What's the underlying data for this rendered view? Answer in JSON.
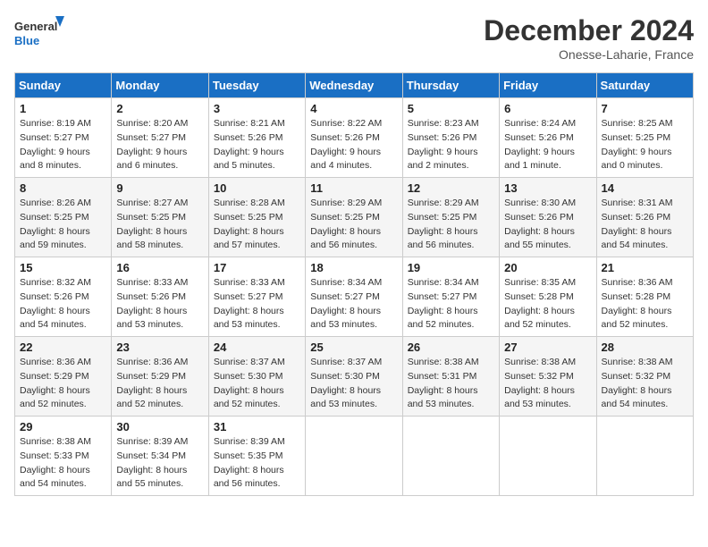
{
  "logo": {
    "line1": "General",
    "line2": "Blue"
  },
  "title": "December 2024",
  "subtitle": "Onesse-Laharie, France",
  "days_header": [
    "Sunday",
    "Monday",
    "Tuesday",
    "Wednesday",
    "Thursday",
    "Friday",
    "Saturday"
  ],
  "weeks": [
    [
      {
        "day": "1",
        "info": "Sunrise: 8:19 AM\nSunset: 5:27 PM\nDaylight: 9 hours\nand 8 minutes."
      },
      {
        "day": "2",
        "info": "Sunrise: 8:20 AM\nSunset: 5:27 PM\nDaylight: 9 hours\nand 6 minutes."
      },
      {
        "day": "3",
        "info": "Sunrise: 8:21 AM\nSunset: 5:26 PM\nDaylight: 9 hours\nand 5 minutes."
      },
      {
        "day": "4",
        "info": "Sunrise: 8:22 AM\nSunset: 5:26 PM\nDaylight: 9 hours\nand 4 minutes."
      },
      {
        "day": "5",
        "info": "Sunrise: 8:23 AM\nSunset: 5:26 PM\nDaylight: 9 hours\nand 2 minutes."
      },
      {
        "day": "6",
        "info": "Sunrise: 8:24 AM\nSunset: 5:26 PM\nDaylight: 9 hours\nand 1 minute."
      },
      {
        "day": "7",
        "info": "Sunrise: 8:25 AM\nSunset: 5:25 PM\nDaylight: 9 hours\nand 0 minutes."
      }
    ],
    [
      {
        "day": "8",
        "info": "Sunrise: 8:26 AM\nSunset: 5:25 PM\nDaylight: 8 hours\nand 59 minutes."
      },
      {
        "day": "9",
        "info": "Sunrise: 8:27 AM\nSunset: 5:25 PM\nDaylight: 8 hours\nand 58 minutes."
      },
      {
        "day": "10",
        "info": "Sunrise: 8:28 AM\nSunset: 5:25 PM\nDaylight: 8 hours\nand 57 minutes."
      },
      {
        "day": "11",
        "info": "Sunrise: 8:29 AM\nSunset: 5:25 PM\nDaylight: 8 hours\nand 56 minutes."
      },
      {
        "day": "12",
        "info": "Sunrise: 8:29 AM\nSunset: 5:25 PM\nDaylight: 8 hours\nand 56 minutes."
      },
      {
        "day": "13",
        "info": "Sunrise: 8:30 AM\nSunset: 5:26 PM\nDaylight: 8 hours\nand 55 minutes."
      },
      {
        "day": "14",
        "info": "Sunrise: 8:31 AM\nSunset: 5:26 PM\nDaylight: 8 hours\nand 54 minutes."
      }
    ],
    [
      {
        "day": "15",
        "info": "Sunrise: 8:32 AM\nSunset: 5:26 PM\nDaylight: 8 hours\nand 54 minutes."
      },
      {
        "day": "16",
        "info": "Sunrise: 8:33 AM\nSunset: 5:26 PM\nDaylight: 8 hours\nand 53 minutes."
      },
      {
        "day": "17",
        "info": "Sunrise: 8:33 AM\nSunset: 5:27 PM\nDaylight: 8 hours\nand 53 minutes."
      },
      {
        "day": "18",
        "info": "Sunrise: 8:34 AM\nSunset: 5:27 PM\nDaylight: 8 hours\nand 53 minutes."
      },
      {
        "day": "19",
        "info": "Sunrise: 8:34 AM\nSunset: 5:27 PM\nDaylight: 8 hours\nand 52 minutes."
      },
      {
        "day": "20",
        "info": "Sunrise: 8:35 AM\nSunset: 5:28 PM\nDaylight: 8 hours\nand 52 minutes."
      },
      {
        "day": "21",
        "info": "Sunrise: 8:36 AM\nSunset: 5:28 PM\nDaylight: 8 hours\nand 52 minutes."
      }
    ],
    [
      {
        "day": "22",
        "info": "Sunrise: 8:36 AM\nSunset: 5:29 PM\nDaylight: 8 hours\nand 52 minutes."
      },
      {
        "day": "23",
        "info": "Sunrise: 8:36 AM\nSunset: 5:29 PM\nDaylight: 8 hours\nand 52 minutes."
      },
      {
        "day": "24",
        "info": "Sunrise: 8:37 AM\nSunset: 5:30 PM\nDaylight: 8 hours\nand 52 minutes."
      },
      {
        "day": "25",
        "info": "Sunrise: 8:37 AM\nSunset: 5:30 PM\nDaylight: 8 hours\nand 53 minutes."
      },
      {
        "day": "26",
        "info": "Sunrise: 8:38 AM\nSunset: 5:31 PM\nDaylight: 8 hours\nand 53 minutes."
      },
      {
        "day": "27",
        "info": "Sunrise: 8:38 AM\nSunset: 5:32 PM\nDaylight: 8 hours\nand 53 minutes."
      },
      {
        "day": "28",
        "info": "Sunrise: 8:38 AM\nSunset: 5:32 PM\nDaylight: 8 hours\nand 54 minutes."
      }
    ],
    [
      {
        "day": "29",
        "info": "Sunrise: 8:38 AM\nSunset: 5:33 PM\nDaylight: 8 hours\nand 54 minutes."
      },
      {
        "day": "30",
        "info": "Sunrise: 8:39 AM\nSunset: 5:34 PM\nDaylight: 8 hours\nand 55 minutes."
      },
      {
        "day": "31",
        "info": "Sunrise: 8:39 AM\nSunset: 5:35 PM\nDaylight: 8 hours\nand 56 minutes."
      },
      {
        "day": "",
        "info": ""
      },
      {
        "day": "",
        "info": ""
      },
      {
        "day": "",
        "info": ""
      },
      {
        "day": "",
        "info": ""
      }
    ]
  ]
}
